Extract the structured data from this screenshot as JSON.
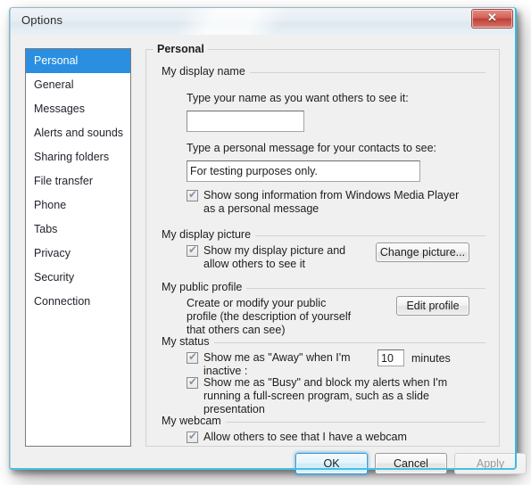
{
  "window": {
    "title": "Options",
    "close_glyph": "✕",
    "close_label": "Close"
  },
  "sidebar": {
    "items": [
      {
        "label": "Personal",
        "selected": true
      },
      {
        "label": "General",
        "selected": false
      },
      {
        "label": "Messages",
        "selected": false
      },
      {
        "label": "Alerts and sounds",
        "selected": false
      },
      {
        "label": "Sharing folders",
        "selected": false
      },
      {
        "label": "File transfer",
        "selected": false
      },
      {
        "label": "Phone",
        "selected": false
      },
      {
        "label": "Tabs",
        "selected": false
      },
      {
        "label": "Privacy",
        "selected": false
      },
      {
        "label": "Security",
        "selected": false
      },
      {
        "label": "Connection",
        "selected": false
      }
    ]
  },
  "main": {
    "group_title": "Personal",
    "display_name": {
      "caption": "My display name",
      "name_prompt": "Type your name as you want others to see it:",
      "name_value": "",
      "message_prompt": "Type a personal message for your contacts to see:",
      "message_value": "For testing purposes only.",
      "song_checkbox": {
        "label": "Show song information from Windows Media Player as a personal message",
        "checked": true,
        "tick": "✔"
      }
    },
    "display_picture": {
      "caption": "My display picture",
      "checkbox": {
        "label": "Show my display picture and allow others to see it",
        "checked": true,
        "tick": "✔"
      },
      "button": "Change picture..."
    },
    "public_profile": {
      "caption": "My public profile",
      "description": "Create or modify your public profile (the description of yourself that others can see)",
      "button": "Edit profile"
    },
    "status": {
      "caption": "My status",
      "away": {
        "label_before": "Show me as \"Away\" when I'm inactive :",
        "minutes_value": "10",
        "label_after": "minutes",
        "checked": true,
        "tick": "✔"
      },
      "busy": {
        "label": "Show me as \"Busy\" and block my alerts when I'm running a full-screen program, such as a slide presentation",
        "checked": true,
        "tick": "✔"
      }
    },
    "webcam": {
      "caption": "My webcam",
      "checkbox": {
        "label": "Allow others to see that I have a webcam",
        "checked": true,
        "tick": "✔"
      }
    }
  },
  "footer": {
    "ok": "OK",
    "cancel": "Cancel",
    "apply": "Apply"
  },
  "colors": {
    "selection_blue": "#2a8fe0",
    "aero_rim": "#39b9e0",
    "close_red": "#bc4136",
    "dialog_bg": "#f0f0f0"
  }
}
